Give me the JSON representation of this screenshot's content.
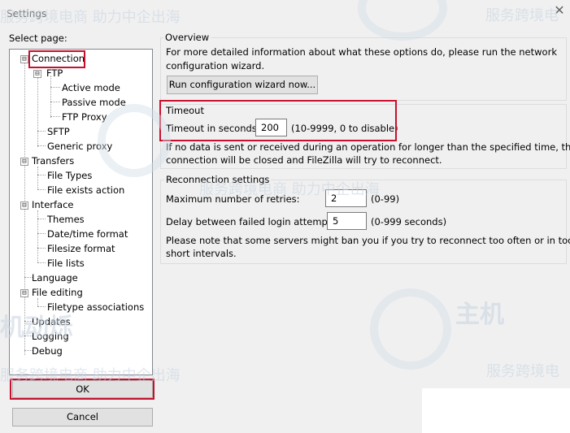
{
  "window": {
    "title": "Settings",
    "close_icon": "close-icon"
  },
  "select_page_label": "Select page:",
  "tree": {
    "connection": "Connection",
    "ftp": "FTP",
    "active_mode": "Active mode",
    "passive_mode": "Passive mode",
    "ftp_proxy": "FTP Proxy",
    "sftp": "SFTP",
    "generic_proxy": "Generic proxy",
    "transfers": "Transfers",
    "file_types": "File Types",
    "file_exists_action": "File exists action",
    "interface": "Interface",
    "themes": "Themes",
    "date_time_format": "Date/time format",
    "filesize_format": "Filesize format",
    "file_lists": "File lists",
    "language": "Language",
    "file_editing": "File editing",
    "filetype_associations": "Filetype associations",
    "updates": "Updates",
    "logging": "Logging",
    "debug": "Debug",
    "expander_collapse": "⊟"
  },
  "buttons": {
    "ok": "OK",
    "cancel": "Cancel"
  },
  "overview": {
    "title": "Overview",
    "text_line1": "For more detailed information about what these options do, please run the network",
    "text_line2": "configuration wizard.",
    "wizard_button": "Run configuration wizard now..."
  },
  "timeout": {
    "title": "Timeout",
    "label": "Timeout in seconds:",
    "value": "200",
    "hint": "(10-9999, 0 to disable)",
    "note_line1": "If no data is sent or received during an operation for longer than the specified time, the",
    "note_line2": "connection will be closed and FileZilla will try to reconnect."
  },
  "reconnection": {
    "title": "Reconnection settings",
    "retries_label": "Maximum number of retries:",
    "retries_value": "2",
    "retries_hint": "(0-99)",
    "delay_label": "Delay between failed login attempts:",
    "delay_value": "5",
    "delay_hint": "(0-999 seconds)",
    "note_line1": "Please note that some servers might ban you if you try to reconnect too often or in too",
    "note_line2": "short intervals."
  },
  "watermark": {
    "slogan": "服务跨境电商 助力中企出海",
    "brand_short": "服务跨境电",
    "brand_big": "主机",
    "brand_big2": "机动烁"
  },
  "colors": {
    "highlight": "#c8102e",
    "watermark": "#c7d3e0"
  }
}
